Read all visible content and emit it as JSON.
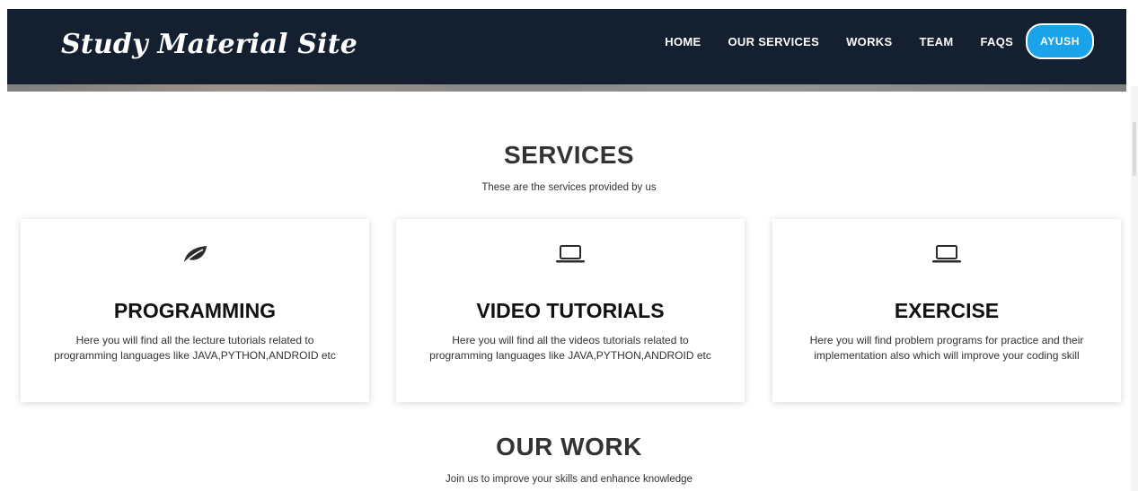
{
  "brand": "Study Material Site",
  "nav": {
    "home": "HOME",
    "services": "OUR SERVICES",
    "works": "WORKS",
    "team": "TEAM",
    "faqs": "FAQS",
    "user_button": "AYUSH"
  },
  "services": {
    "title": "SERVICES",
    "subtitle": "These are the services provided by us",
    "cards": [
      {
        "icon": "leaf-icon",
        "title": "PROGRAMMING",
        "text": "Here you will find all the lecture tutorials related to programming languages like JAVA,PYTHON,ANDROID etc"
      },
      {
        "icon": "laptop-icon",
        "title": "VIDEO TUTORIALS",
        "text": "Here you will find all the videos tutorials related to programming languages like JAVA,PYTHON,ANDROID etc"
      },
      {
        "icon": "laptop-icon",
        "title": "EXERCISE",
        "text": "Here you will find problem programs for practice and their implementation also which will improve your coding skill"
      }
    ]
  },
  "work": {
    "title": "OUR WORK",
    "subtitle": "Join us to improve your skills and enhance knowledge"
  },
  "colors": {
    "navbar": "#14202f",
    "accent": "#1aa3e8"
  }
}
